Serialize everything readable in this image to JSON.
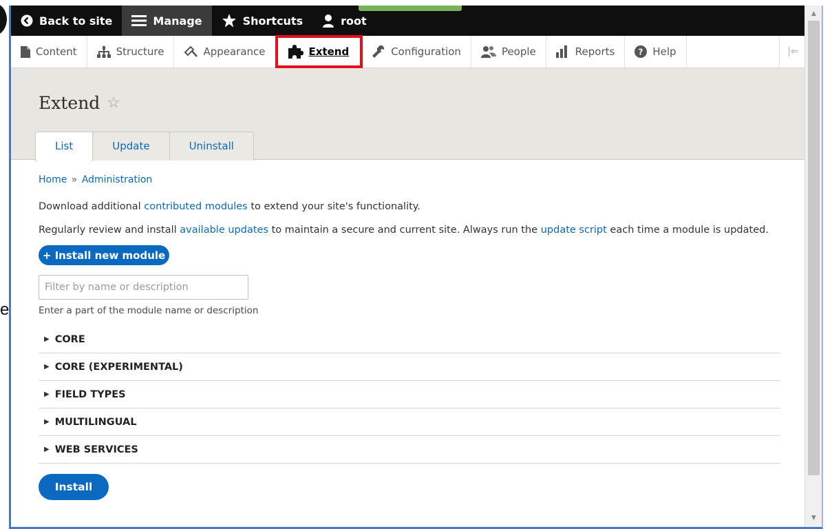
{
  "toolbar": {
    "back_label": "Back to site",
    "manage_label": "Manage",
    "shortcuts_label": "Shortcuts",
    "user_label": "root"
  },
  "tray": {
    "items": [
      {
        "label": "Content",
        "icon": "file-icon"
      },
      {
        "label": "Structure",
        "icon": "sitemap-icon"
      },
      {
        "label": "Appearance",
        "icon": "paintbrush-icon"
      },
      {
        "label": "Extend",
        "icon": "puzzle-icon"
      },
      {
        "label": "Configuration",
        "icon": "wrench-icon"
      },
      {
        "label": "People",
        "icon": "people-icon"
      },
      {
        "label": "Reports",
        "icon": "bar-chart-icon"
      },
      {
        "label": "Help",
        "icon": "help-icon"
      }
    ],
    "collapse_glyph": "|⇐"
  },
  "header": {
    "title": "Extend",
    "tabs": [
      "List",
      "Update",
      "Uninstall"
    ]
  },
  "main": {
    "breadcrumb_home": "Home",
    "breadcrumb_sep": "»",
    "breadcrumb_admin": "Administration",
    "p1_before": "Download additional ",
    "p1_link": "contributed modules",
    "p1_after": " to extend your site's functionality.",
    "p2_before": "Regularly review and install ",
    "p2_link1": "available updates",
    "p2_middle": " to maintain a secure and current site. Always run the ",
    "p2_link2": "update script",
    "p2_after": " each time a module is updated.",
    "install_new_label": "+ Install new module",
    "filter_placeholder": "Filter by name or description",
    "filter_value": "",
    "filter_hint": "Enter a part of the module name or description",
    "packages": [
      "CORE",
      "CORE (EXPERIMENTAL)",
      "FIELD TYPES",
      "MULTILINGUAL",
      "WEB SERVICES"
    ],
    "install_label": "Install"
  },
  "colors": {
    "accent_blue": "#0b6ac0",
    "link_blue": "#0b69b3",
    "highlight_red": "#e3101b",
    "toolbar_black": "#0f0f0f"
  }
}
